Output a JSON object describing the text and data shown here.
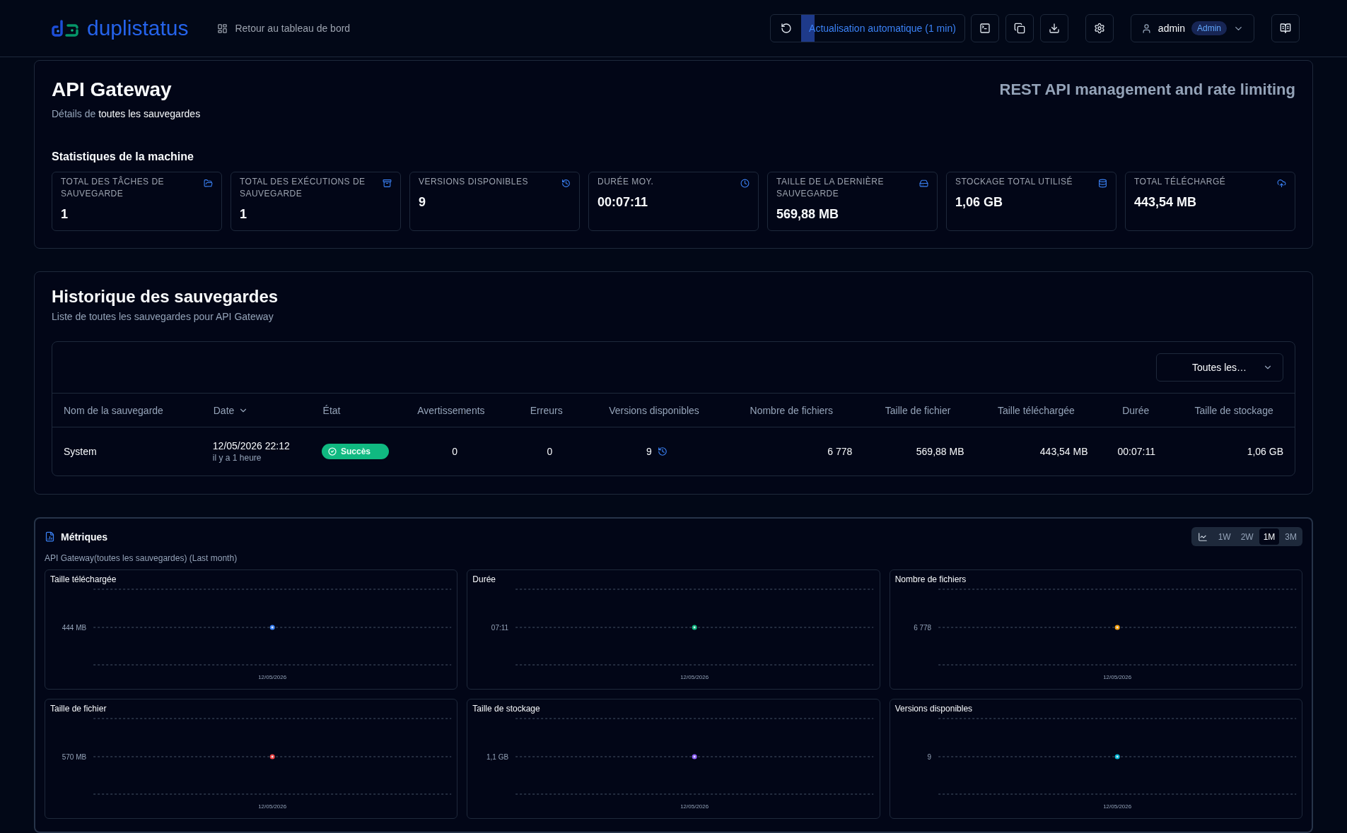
{
  "header": {
    "brand": "duplistatus",
    "back_link": "Retour au tableau de bord",
    "auto_refresh": {
      "label": "Actualisation automatique (1 min)",
      "level": 0.08
    },
    "user": {
      "name": "admin",
      "role": "Admin"
    }
  },
  "machine": {
    "title": "API Gateway",
    "subtitle": {
      "prefix": "Détails de",
      "highlight": "toutes les sauvegardes"
    },
    "description": "REST API management and rate limiting",
    "stats_title": "Statistiques de la machine",
    "stats": [
      {
        "label": "TOTAL DES TÂCHES DE SAUVEGARDE",
        "value": "1"
      },
      {
        "label": "TOTAL DES EXÉCUTIONS DE SAUVEGARDE",
        "value": "1"
      },
      {
        "label": "VERSIONS DISPONIBLES",
        "value": "9"
      },
      {
        "label": "DURÉE MOY.",
        "value": "00:07:11"
      },
      {
        "label": "TAILLE DE LA DERNIÈRE SAUVEGARDE",
        "value": "569,88 MB"
      },
      {
        "label": "STOCKAGE TOTAL UTILISÉ",
        "value": "1,06 GB"
      },
      {
        "label": "TOTAL TÉLÉCHARGÉ",
        "value": "443,54 MB"
      }
    ]
  },
  "history": {
    "title": "Historique des sauvegardes",
    "subtitle": "Liste de toutes les sauvegardes pour API Gateway",
    "filter": {
      "value": "Toutes les…"
    },
    "columns": [
      {
        "label": "Nom de la sauvegarde",
        "sorted": false
      },
      {
        "label": "Date",
        "sorted": true
      },
      {
        "label": "État",
        "sorted": false
      },
      {
        "label": "Avertissements",
        "sorted": false
      },
      {
        "label": "Erreurs",
        "sorted": false
      },
      {
        "label": "Versions disponibles",
        "sorted": false
      },
      {
        "label": "Nombre de fichiers",
        "sorted": false
      },
      {
        "label": "Taille de fichier",
        "sorted": false
      },
      {
        "label": "Taille téléchargée",
        "sorted": false
      },
      {
        "label": "Durée",
        "sorted": false
      },
      {
        "label": "Taille de stockage",
        "sorted": false
      }
    ],
    "rows": [
      {
        "name": "System",
        "date": "12/05/2026 22:12",
        "date_relative": "il y a 1 heure",
        "status": {
          "label": "Succès",
          "kind": "success"
        },
        "warnings": "0",
        "errors": "0",
        "versions": "9",
        "file_count": "6 778",
        "file_size": "569,88 MB",
        "uploaded_size": "443,54 MB",
        "duration": "00:07:11",
        "storage_size": "1,06 GB"
      }
    ]
  },
  "metrics": {
    "title": "Métriques",
    "subtitle": "API Gateway(toutes les sauvegardes) (Last month)",
    "ranges": [
      {
        "label": "1W",
        "selected": false
      },
      {
        "label": "2W",
        "selected": false
      },
      {
        "label": "1M",
        "selected": true
      },
      {
        "label": "3M",
        "selected": false
      }
    ],
    "charts": [
      {
        "title": "Taille téléchargée",
        "y_label": "444 MB",
        "x_label": "12/05/2026",
        "color": "#3b82f6"
      },
      {
        "title": "Durée",
        "y_label": "07:11",
        "x_label": "12/05/2026",
        "color": "#10b981"
      },
      {
        "title": "Nombre de fichiers",
        "y_label": "6 778",
        "x_label": "12/05/2026",
        "color": "#f59e0b"
      },
      {
        "title": "Taille de fichier",
        "y_label": "570 MB",
        "x_label": "12/05/2026",
        "color": "#ef4444"
      },
      {
        "title": "Taille de stockage",
        "y_label": "1,1 GB",
        "x_label": "12/05/2026",
        "color": "#8b5cf6"
      },
      {
        "title": "Versions disponibles",
        "y_label": "9",
        "x_label": "12/05/2026",
        "color": "#06b6d4"
      }
    ]
  }
}
